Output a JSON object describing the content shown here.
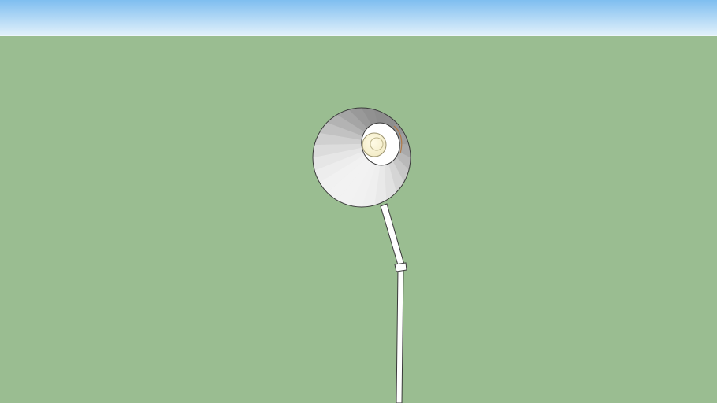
{
  "scene": {
    "subject": "floor-lamp-3d-model",
    "colors": {
      "sky_top": "#7fbef0",
      "sky_bottom": "#e4f2fb",
      "ground": "#9abd91",
      "lamp_white": "#ffffff",
      "lamp_outline": "#3a3a3a",
      "shade_outer": "#f2f2f2",
      "shade_shadow": "#8d8d8d",
      "bulb": "#f3ecc7",
      "bulb_highlight": "#fffbe6"
    }
  }
}
